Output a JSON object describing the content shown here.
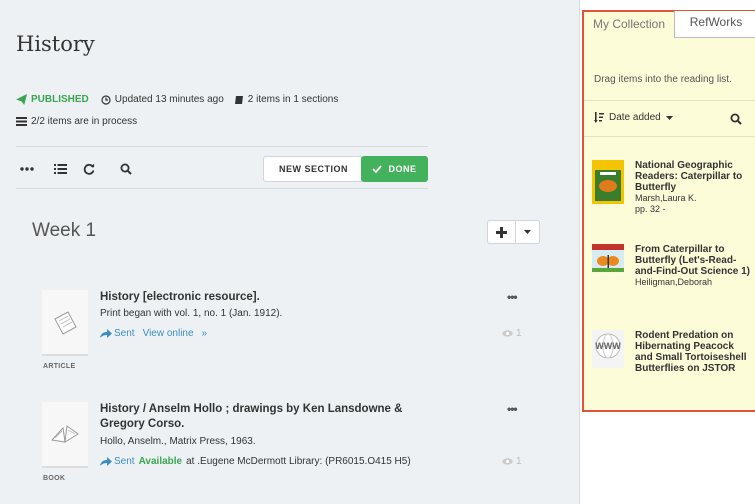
{
  "page": {
    "title": "History",
    "status": "PUBLISHED",
    "updated": "Updated 13 minutes ago",
    "sections_info": "2 items in 1 sections",
    "process_info": "2/2 items are in process"
  },
  "toolbar": {
    "new_section_label": "NEW SECTION",
    "done_label": "DONE"
  },
  "section": {
    "name": "Week 1"
  },
  "items": [
    {
      "title": "History [electronic resource].",
      "subtitle": "Print began with vol. 1, no. 1 (Jan. 1912).",
      "sent": "Sent",
      "link": "View online",
      "link_arrow": "»",
      "views": "1",
      "type": "ARTICLE"
    },
    {
      "title": "History / Anselm Hollo ; drawings by Ken Lansdowne & Gregory Corso.",
      "subtitle": "Hollo, Anselm., Matrix Press, 1963.",
      "sent": "Sent",
      "availability": "Available",
      "location": "at .Eugene McDermott Library: (PR6015.O415 H5)",
      "views": "1",
      "type": "BOOK"
    }
  ],
  "panel": {
    "tab_my": "My Collection",
    "tab_refworks": "RefWorks",
    "hint": "Drag items into the reading list.",
    "sort_label": "Date added",
    "items": [
      {
        "title": "National Geographic Readers: Caterpillar to Butterfly",
        "author": "Marsh,Laura K.",
        "pages": "pp. 32 -"
      },
      {
        "title": "From Caterpillar to Butterfly (Let's-Read-and-Find-Out Science 1)",
        "author": "Heiligman,Deborah"
      },
      {
        "title": "Rodent Predation on Hibernating Peacock and Small Tortoiseshell Butterflies on JSTOR",
        "thumb_text": "WWW"
      }
    ]
  },
  "colors": {
    "accent_green": "#44b25c",
    "link_blue": "#3d8ec4",
    "panel_bg": "#fdfcd9",
    "panel_border": "#e0533c"
  },
  "icons": [
    "paper-plane-icon",
    "clock-icon",
    "book-icon",
    "list-icon",
    "more-icon",
    "refresh-icon",
    "search-icon",
    "check-icon",
    "plus-icon",
    "caret-down-icon",
    "share-icon",
    "eye-icon",
    "sort-icon"
  ]
}
